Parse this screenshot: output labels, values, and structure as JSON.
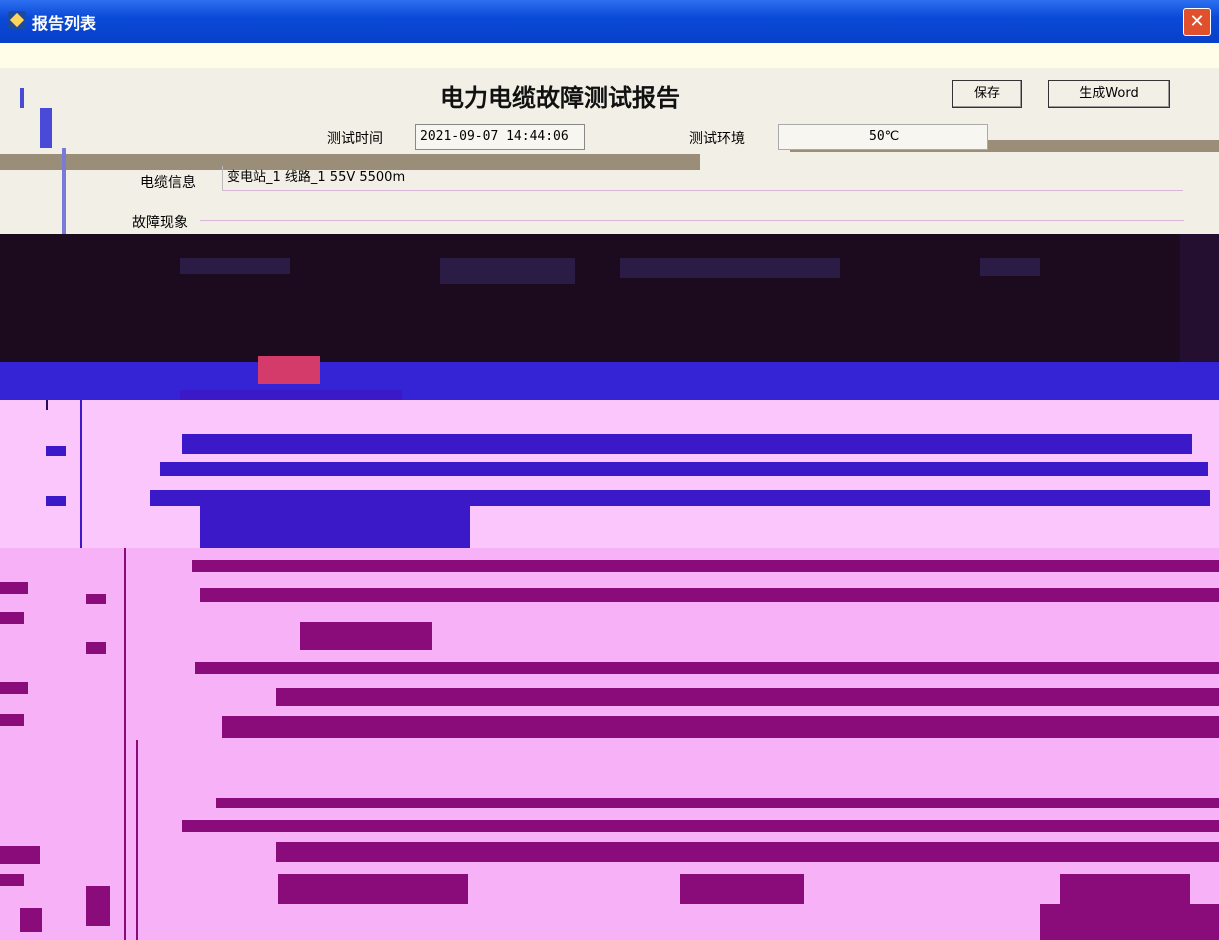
{
  "window": {
    "title": "报告列表",
    "close_glyph": "✕"
  },
  "report": {
    "title": "电力电缆故障测试报告",
    "buttons": {
      "save": "保存",
      "word": "生成Word"
    },
    "test_time_label": "测试时间",
    "test_time_value": "2021-09-07 14:44:06",
    "environment_label": "测试环境",
    "environment_value": "50℃",
    "cable_info_label": "电缆信息",
    "cable_info_value": "变电站_1  线路_1  55V  5500m",
    "fault_label": "故障现象"
  },
  "colors": {
    "titlebar": "#0a4ad8",
    "header_bg": "#f2f0e6",
    "dark_band": "#1c0a1e",
    "blue_band": "#3424d6",
    "pink_body": "#f7b1f7",
    "purple_bars": "#8a0c7a"
  }
}
